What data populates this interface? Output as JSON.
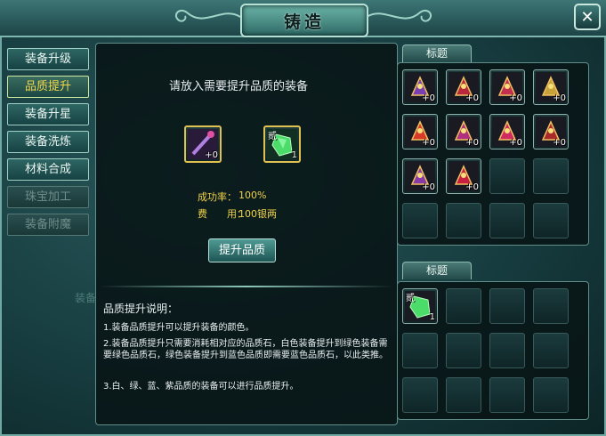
{
  "window": {
    "title": "铸造",
    "close_label": "✕"
  },
  "sidebar": {
    "items": [
      {
        "label": "装备升级",
        "state": "normal"
      },
      {
        "label": "品质提升",
        "state": "active"
      },
      {
        "label": "装备升星",
        "state": "normal"
      },
      {
        "label": "装备洗炼",
        "state": "normal"
      },
      {
        "label": "材料合成",
        "state": "normal"
      },
      {
        "label": "珠宝加工",
        "state": "disabled"
      },
      {
        "label": "装备附魔",
        "state": "disabled"
      }
    ]
  },
  "bg_label": "装备",
  "center": {
    "prompt": "请放入需要提升品质的装备",
    "equip_slot": {
      "icon": "staff-weapon-icon",
      "count": "+0"
    },
    "stone_slot": {
      "icon": "green-gem-icon",
      "char": "贰",
      "count": "1"
    },
    "success_label": "成功率：",
    "success_value": "100%",
    "cost_label": "费　　用：",
    "cost_value": "100银两",
    "upgrade_button": "提升品质"
  },
  "description": {
    "title": "品质提升说明：",
    "lines": [
      "1.装备品质提升可以提升装备的颜色。",
      "2.装备品质提升只需要消耗相对应的品质石，白色装备提升到绿色装备需要绿色品质石，绿色装备提升到蓝色品质即需要蓝色品质石，以此类推。",
      "3.白、绿、蓝、紫品质的装备可以进行品质提升。"
    ]
  },
  "equip_panel": {
    "tab": "标题",
    "items": [
      {
        "icon": "staff-weapon-icon",
        "count": "+0",
        "color": "#7a3fb0"
      },
      {
        "icon": "necklace-icon",
        "count": "+0",
        "color": "#b8283a"
      },
      {
        "icon": "helmet-icon",
        "count": "+0",
        "color": "#c23050"
      },
      {
        "icon": "ring-icon",
        "count": "+0",
        "color": "#c8a23a"
      },
      {
        "icon": "armor-icon",
        "count": "+0",
        "color": "#d83a2a"
      },
      {
        "icon": "amulet-icon",
        "count": "+0",
        "color": "#b03080"
      },
      {
        "icon": "gauntlet-icon",
        "count": "+0",
        "color": "#d02a60"
      },
      {
        "icon": "robe-icon",
        "count": "+0",
        "color": "#a82a2a"
      },
      {
        "icon": "belt-icon",
        "count": "+0",
        "color": "#8a3aa8"
      },
      {
        "icon": "boots-icon",
        "count": "+0",
        "color": "#c82040"
      }
    ]
  },
  "material_panel": {
    "tab": "标题",
    "items": [
      {
        "icon": "green-gem-icon",
        "char": "贰",
        "count": "1"
      }
    ]
  }
}
